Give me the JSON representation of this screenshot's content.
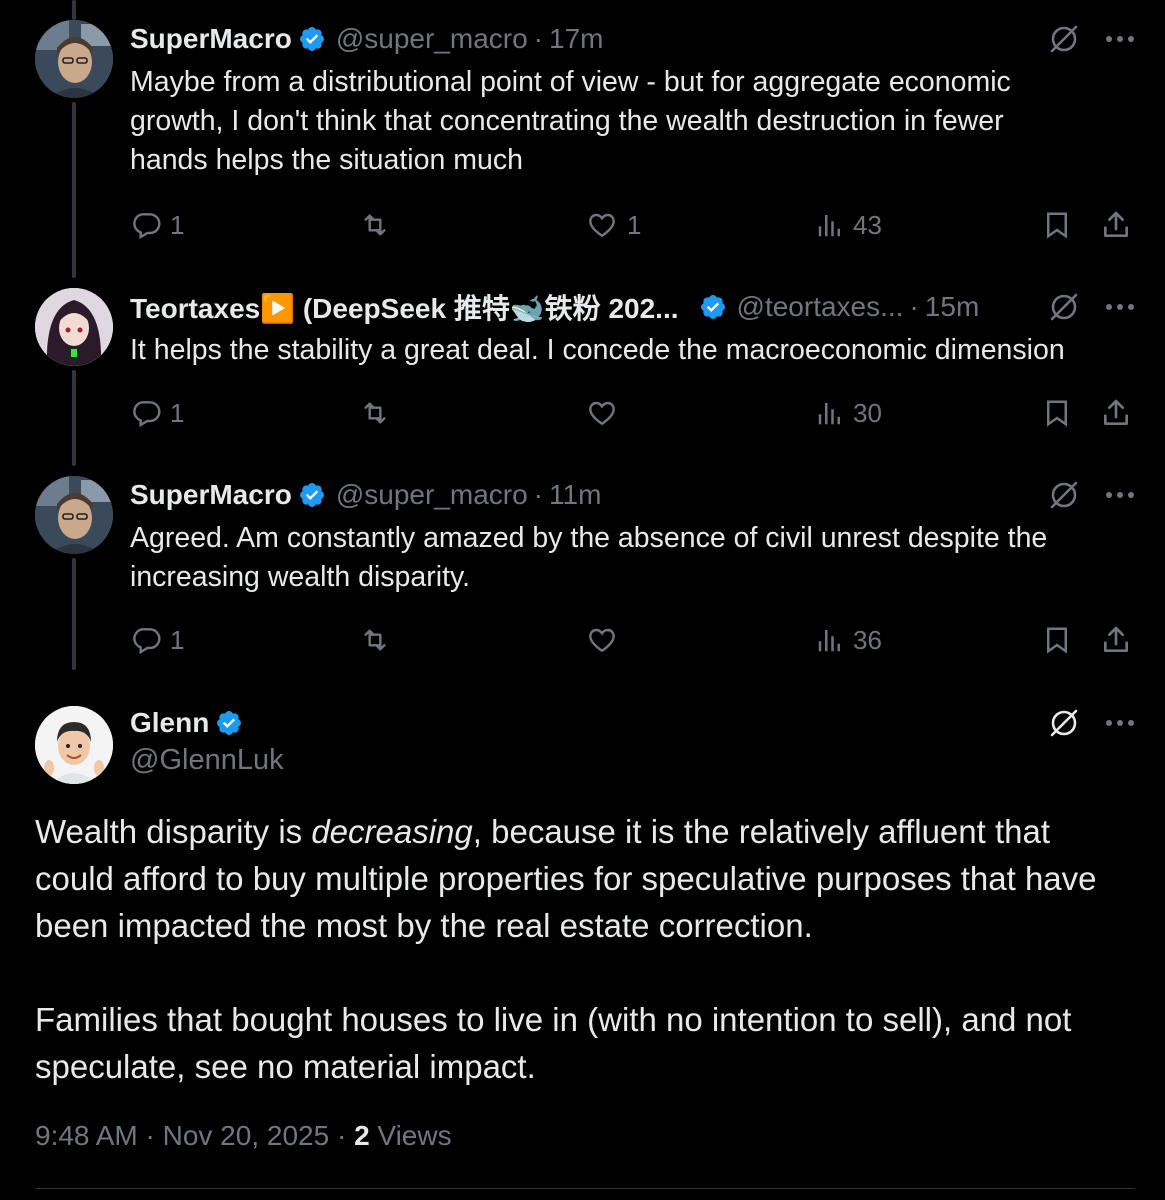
{
  "thread": [
    {
      "name": "SuperMacro",
      "handle": "@super_macro",
      "time": "17m",
      "text_lines": [
        "Maybe from a  distributional point of view - but for aggregate economic",
        "growth, I don't think that concentrating the wealth destruction in fewer",
        "hands helps the situation much"
      ],
      "replies": "1",
      "reposts": "",
      "likes": "1",
      "views": "43"
    },
    {
      "name": "Teortaxes▶️ (DeepSeek 推特🐋铁粉 202...",
      "handle": "@teortaxes...",
      "time": "15m",
      "text_lines": [
        "It helps the stability a great deal. I concede the macroeconomic dimension"
      ],
      "replies": "1",
      "reposts": "",
      "likes": "",
      "views": "30"
    },
    {
      "name": "SuperMacro",
      "handle": "@super_macro",
      "time": "11m",
      "text_lines": [
        "Agreed. Am constantly amazed by the absence of civil unrest despite the",
        "increasing wealth disparity."
      ],
      "replies": "1",
      "reposts": "",
      "likes": "",
      "views": "36"
    }
  ],
  "main": {
    "name": "Glenn",
    "handle": "@GlennLuk",
    "para1_before": "Wealth disparity is ",
    "para1_em": "decreasing",
    "para1_after": ", because it is the relatively affluent that could afford to buy multiple properties for speculative purposes that have been impacted the most by the real estate correction.",
    "para2": "Families that bought houses to live in (with no intention to sell), and not speculate, see no material impact.",
    "timestamp": "9:48 AM · Nov 20, 2025 · ",
    "views_count": "2",
    "views_label": " Views"
  },
  "colors": {
    "background": "#000000",
    "text": "#e7e9ea",
    "muted": "#71767b",
    "verified": "#1d9bf0",
    "thread_line": "#333639"
  },
  "icons": [
    "verified-badge-icon",
    "grok-icon",
    "more-icon",
    "reply-icon",
    "repost-icon",
    "like-icon",
    "views-icon",
    "bookmark-icon",
    "share-icon"
  ]
}
